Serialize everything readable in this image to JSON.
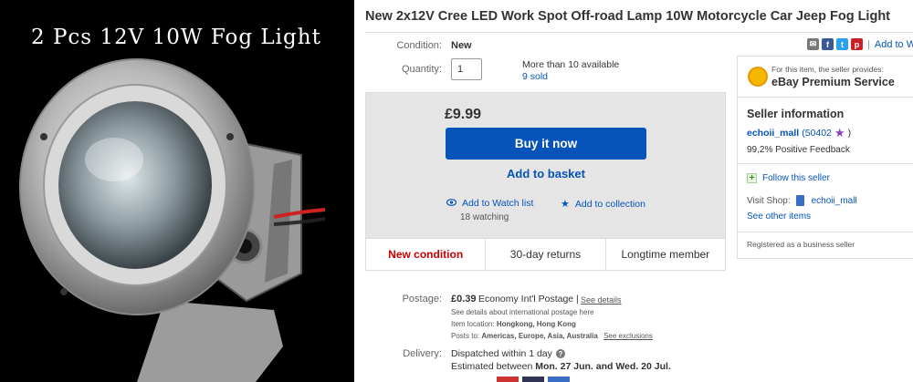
{
  "photo": {
    "caption": "2 Pcs 12V 10W Fog Light"
  },
  "title": "New 2x12V Cree LED Work Spot Off-road Lamp 10W Motorcycle Car Jeep Fog Light",
  "share": {
    "icons": [
      "email-icon",
      "facebook-icon",
      "twitter-icon",
      "pinterest-icon"
    ],
    "separator": "|",
    "watch_label": "Add to W"
  },
  "condition": {
    "label": "Condition:",
    "value": "New"
  },
  "quantity": {
    "label": "Quantity:",
    "value": "1",
    "available": "More than 10 available",
    "sold": "9 sold"
  },
  "buy": {
    "price": "£9.99",
    "buy_now": "Buy it now",
    "add_basket": "Add to basket",
    "watch_list": "Add to Watch list",
    "watching": "18 watching",
    "collection": "Add to collection"
  },
  "tabs": [
    {
      "label": "New condition"
    },
    {
      "label": "30-day returns"
    },
    {
      "label": "Longtime member"
    }
  ],
  "postage": {
    "label": "Postage:",
    "price": "£0.39",
    "service": "Economy Int'l Postage |",
    "see_details": "See details",
    "intl_note": "See details about international postage here",
    "item_location_label": "Item location:",
    "item_location": "Hongkong, Hong Kong",
    "posts_to_label": "Posts to:",
    "posts_to": "Americas, Europe, Asia, Australia",
    "see_exclusions": "See exclusions"
  },
  "delivery": {
    "label": "Delivery:",
    "dispatched": "Dispatched within 1 day",
    "estimated_prefix": "Estimated between",
    "estimated_dates": "Mon. 27 Jun. and Wed. 20 Jul."
  },
  "seller": {
    "premium_note": "For this item, the seller provides:",
    "premium_title": "eBay Premium Service",
    "info_title": "Seller information",
    "name": "echoii_mall",
    "score": "(50402",
    "score_close": ")",
    "positive": "99,2% Positive Feedback",
    "follow": "Follow this seller",
    "visit_label": "Visit Shop:",
    "shop_name": "echoii_mall",
    "other_items": "See other items",
    "registered": "Registered as a business seller"
  },
  "colors": {
    "accent": "#0654ba",
    "alert": "#cc0000",
    "buybox_bg": "#e5e5e5"
  }
}
